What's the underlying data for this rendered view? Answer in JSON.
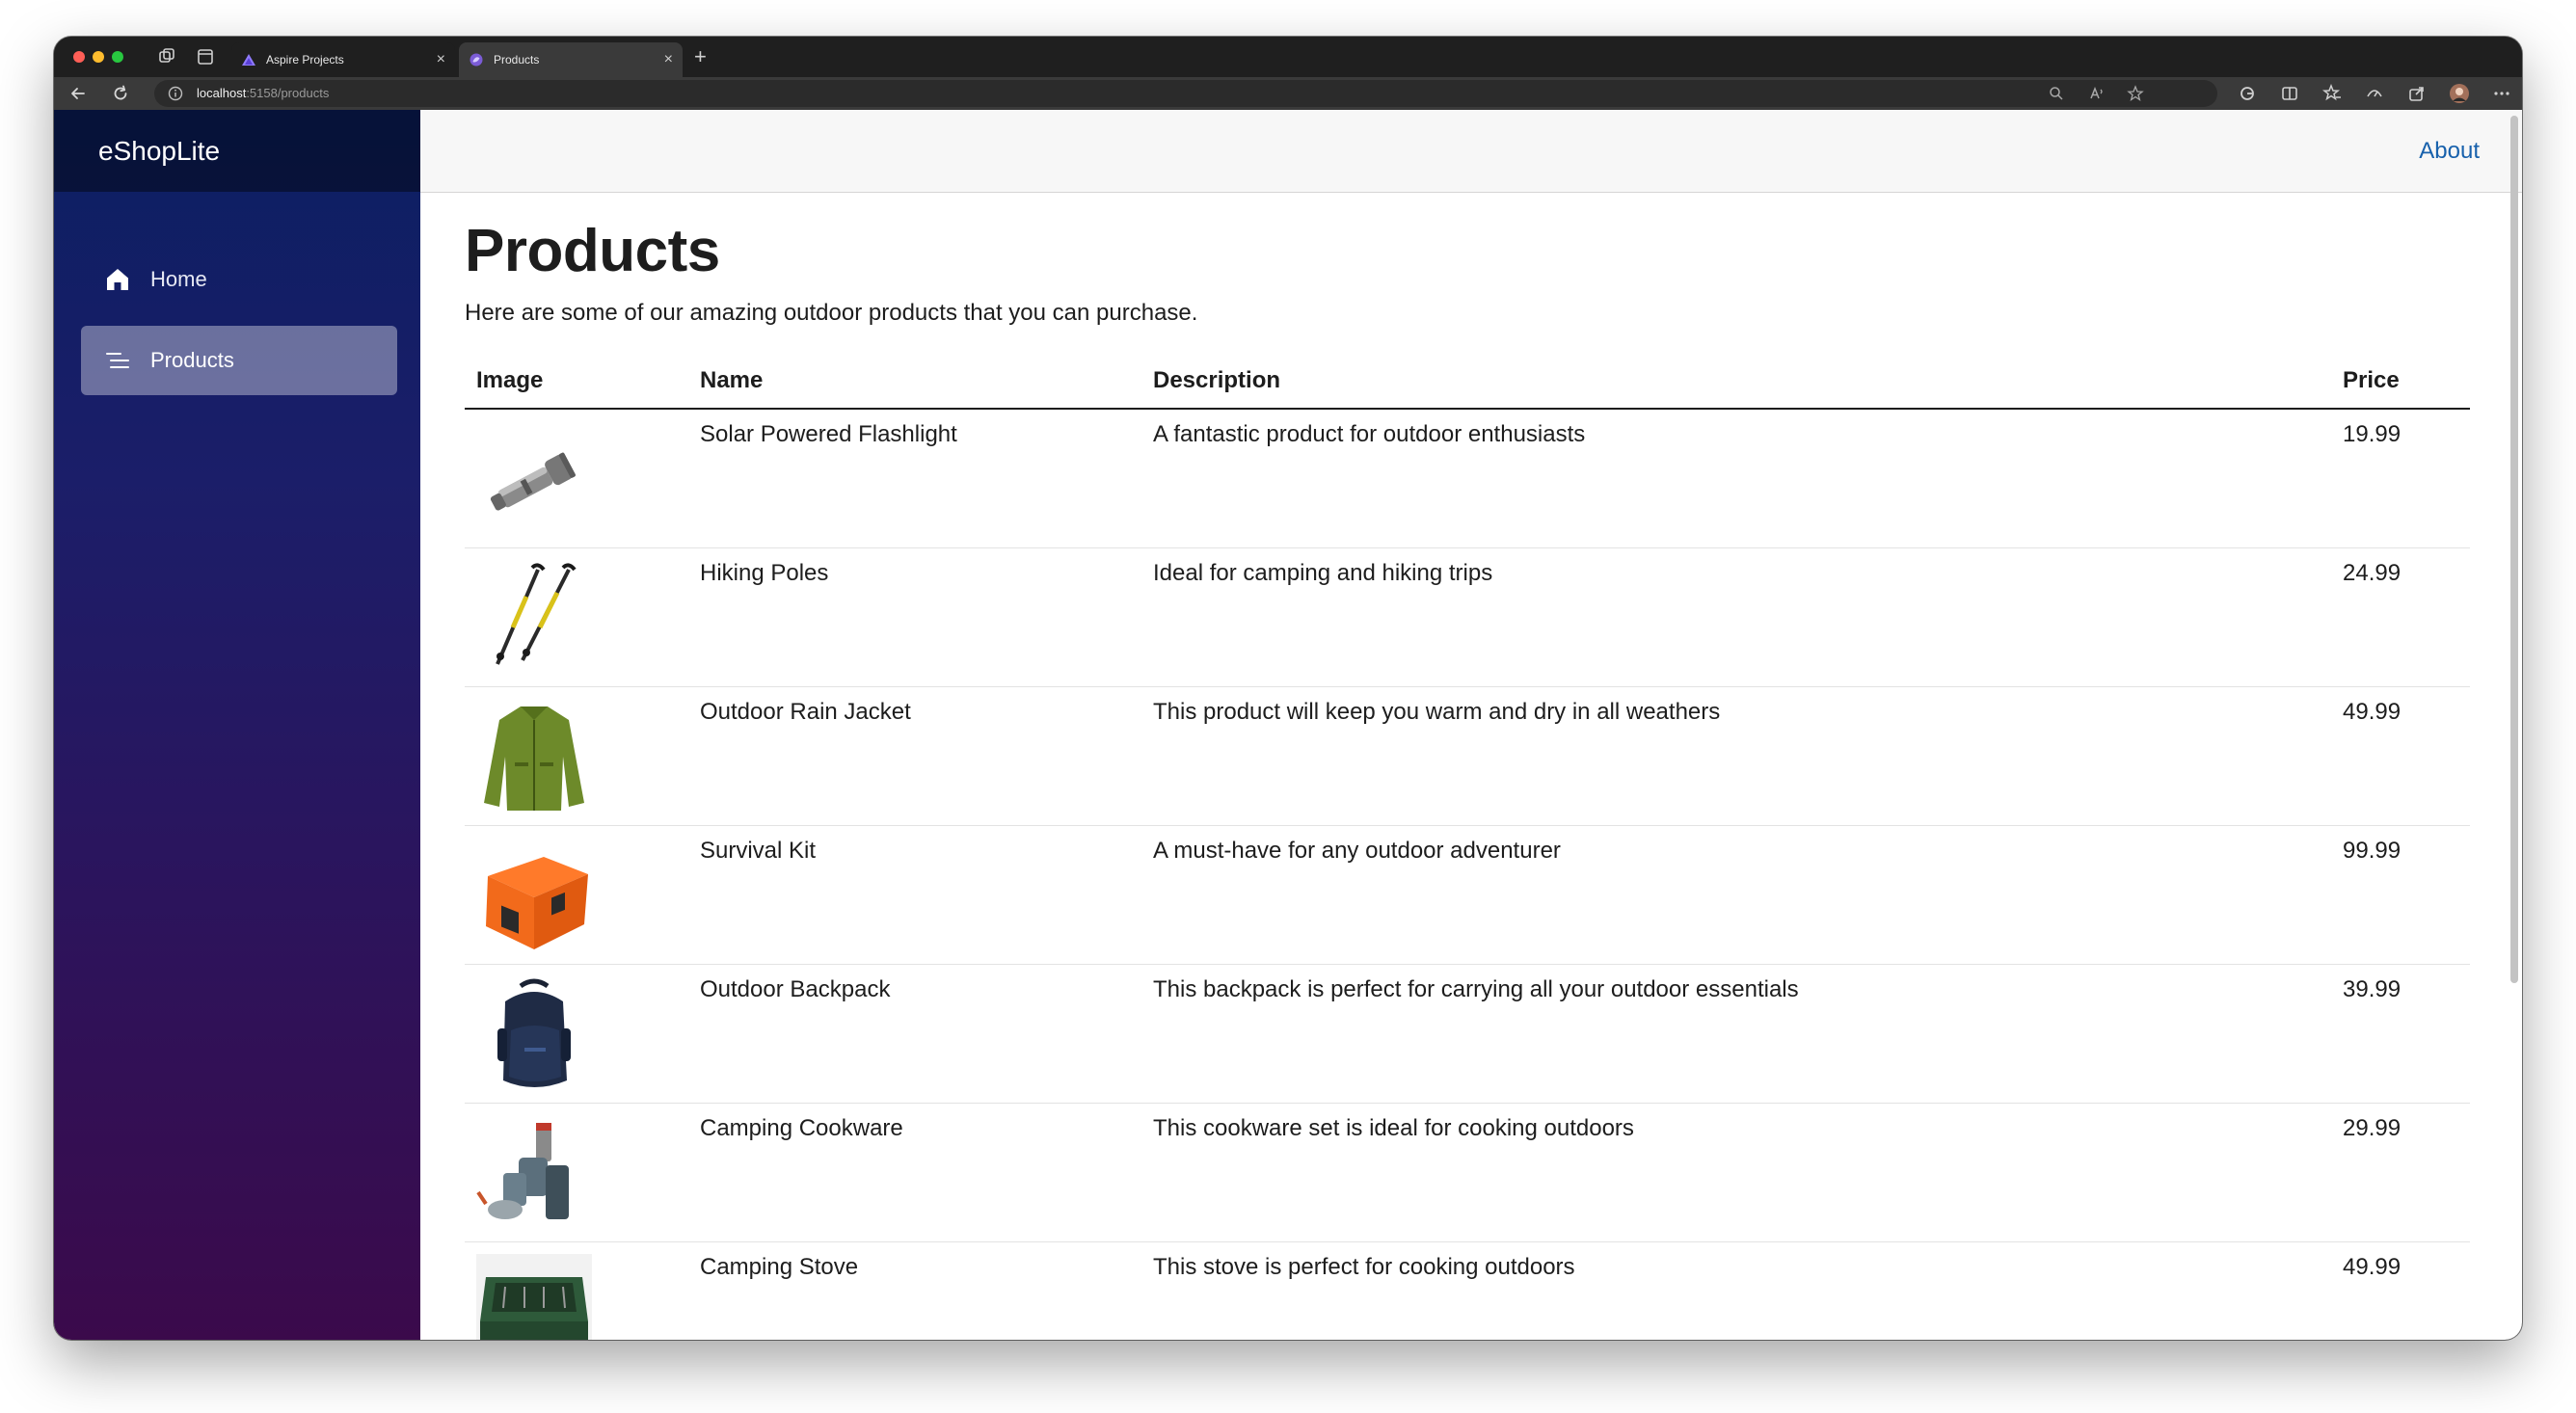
{
  "browser": {
    "tabs": [
      {
        "title": "Aspire Projects",
        "active": false,
        "favicon": "aspire-triangle-icon"
      },
      {
        "title": "Products",
        "active": true,
        "favicon": "blazor-icon"
      }
    ],
    "close_glyph": "×",
    "new_tab_glyph": "+",
    "url_host": "localhost",
    "url_rest": ":5158/products"
  },
  "sidebar": {
    "brand": "eShopLite",
    "items": [
      {
        "label": "Home",
        "icon": "home-icon",
        "active": false
      },
      {
        "label": "Products",
        "icon": "list-icon",
        "active": true
      }
    ]
  },
  "topbar": {
    "about": "About"
  },
  "main": {
    "title": "Products",
    "intro": "Here are some of our amazing outdoor products that you can purchase.",
    "columns": [
      "Image",
      "Name",
      "Description",
      "Price"
    ],
    "rows": [
      {
        "image": "flashlight",
        "name": "Solar Powered Flashlight",
        "description": "A fantastic product for outdoor enthusiasts",
        "price": "19.99"
      },
      {
        "image": "hiking-poles",
        "name": "Hiking Poles",
        "description": "Ideal for camping and hiking trips",
        "price": "24.99"
      },
      {
        "image": "rain-jacket",
        "name": "Outdoor Rain Jacket",
        "description": "This product will keep you warm and dry in all weathers",
        "price": "49.99"
      },
      {
        "image": "survival-kit",
        "name": "Survival Kit",
        "description": "A must-have for any outdoor adventurer",
        "price": "99.99"
      },
      {
        "image": "backpack",
        "name": "Outdoor Backpack",
        "description": "This backpack is perfect for carrying all your outdoor essentials",
        "price": "39.99"
      },
      {
        "image": "cookware",
        "name": "Camping Cookware",
        "description": "This cookware set is ideal for cooking outdoors",
        "price": "29.99"
      },
      {
        "image": "stove",
        "name": "Camping Stove",
        "description": "This stove is perfect for cooking outdoors",
        "price": "49.99"
      }
    ]
  },
  "colors": {
    "link": "#1861ac",
    "sidebar_top": "#0b1f62",
    "sidebar_bottom": "#3b0a4b",
    "text": "#1d1d1d"
  }
}
